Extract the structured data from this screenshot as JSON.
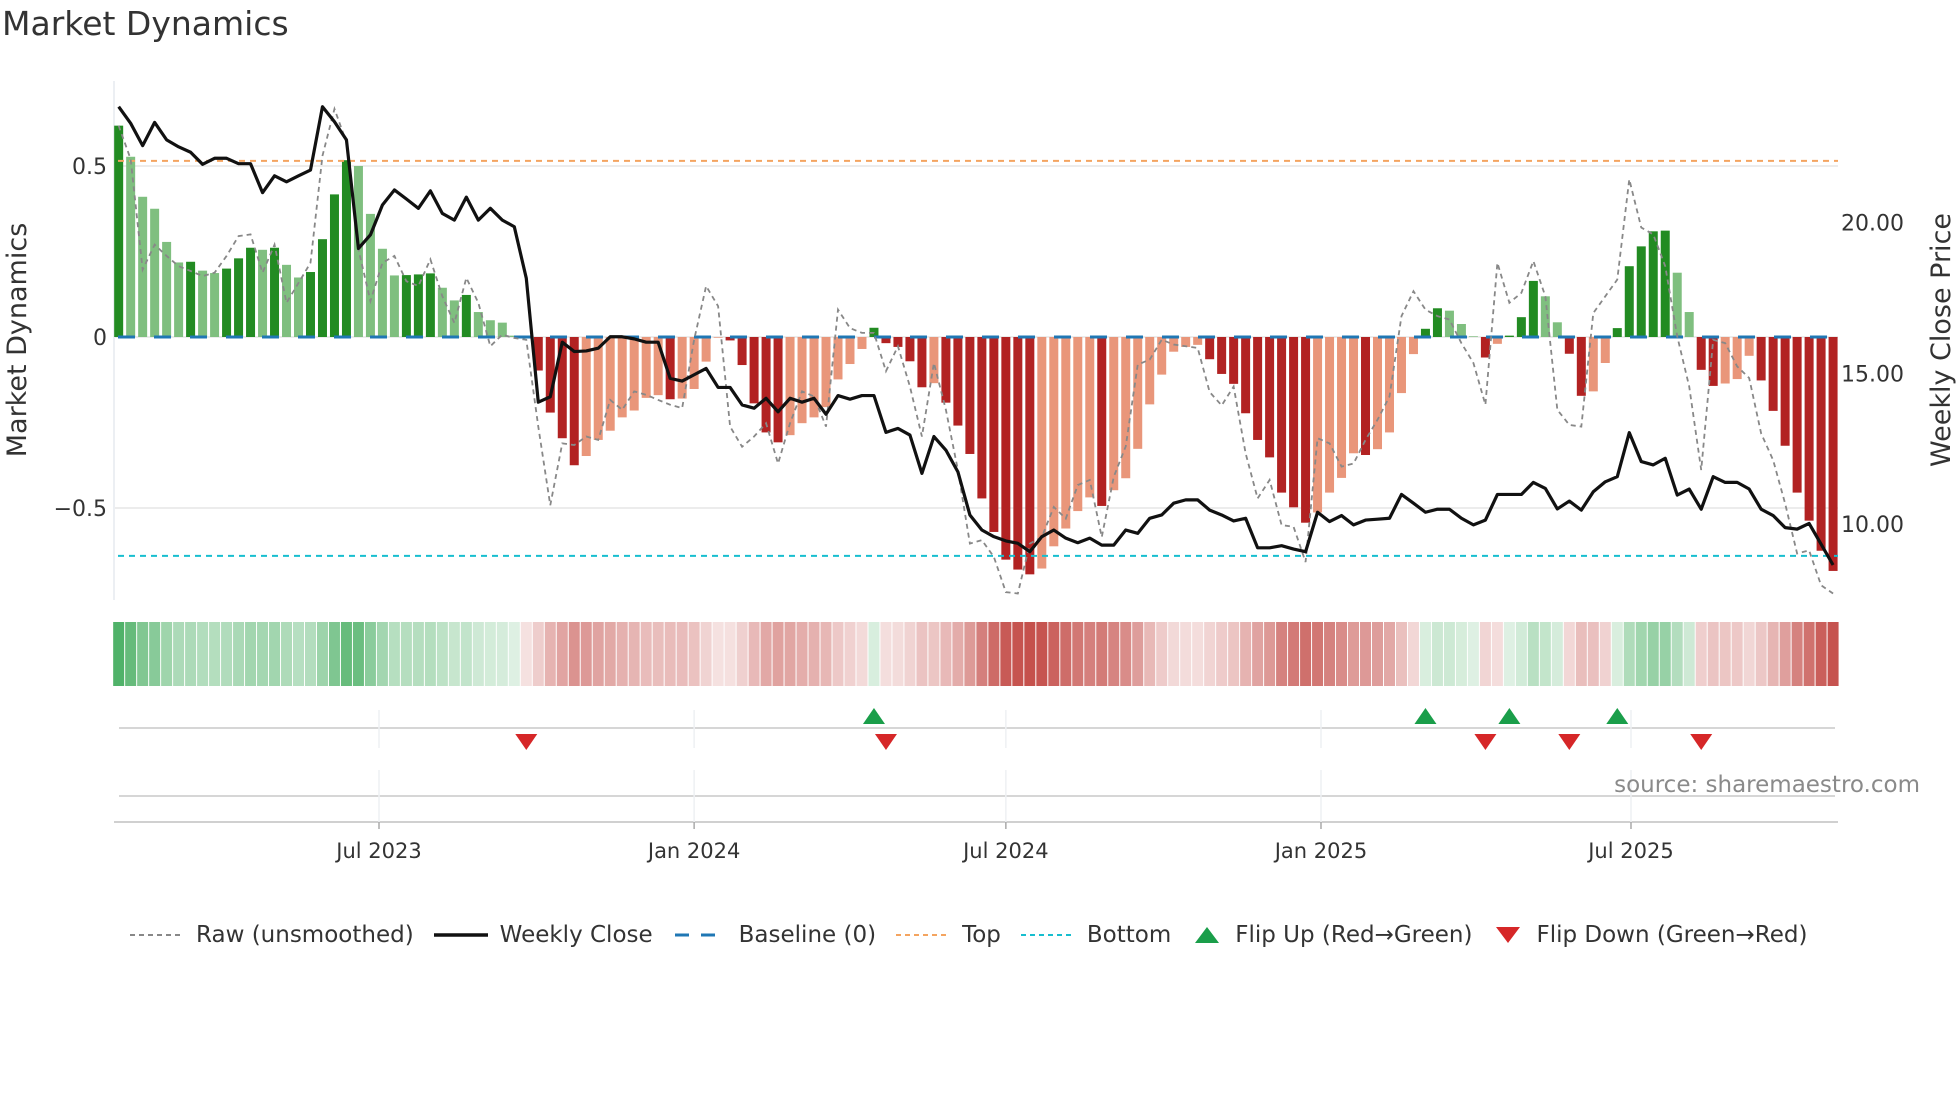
{
  "title": "Market Dynamics",
  "source": "source: sharemaestro.com",
  "colors": {
    "green_strong": "#228b22",
    "green_weak": "#7fbf7f",
    "red_strong": "#b22222",
    "red_weak": "#e9967a",
    "baseline": "#1f77b4",
    "top": "#f4a460",
    "bottom": "#17becf",
    "raw": "#888888",
    "close": "#111111",
    "flip_up": "#1a9e4a",
    "flip_down": "#d62728"
  },
  "legend": [
    {
      "key": "raw",
      "label": "Raw (unsmoothed)"
    },
    {
      "key": "close",
      "label": "Weekly Close"
    },
    {
      "key": "baseline",
      "label": "Baseline (0)"
    },
    {
      "key": "top",
      "label": "Top"
    },
    {
      "key": "bottom",
      "label": "Bottom"
    },
    {
      "key": "flip_up",
      "label": "Flip Up (Red→Green)"
    },
    {
      "key": "flip_down",
      "label": "Flip Down (Green→Red)"
    }
  ],
  "chart_data": {
    "type": "bar",
    "title": "Market Dynamics",
    "ylabel": "Market Dynamics",
    "y2label": "Weekly Close Price",
    "ylim": [
      -0.75,
      0.75
    ],
    "y2lim": [
      7.5,
      24.7
    ],
    "yticks": [
      {
        "v": 0.5,
        "label": "0.5"
      },
      {
        "v": 0,
        "label": "0"
      },
      {
        "v": -0.5,
        "label": "−0.5"
      }
    ],
    "y2ticks": [
      {
        "v": 20,
        "label": "20.00"
      },
      {
        "v": 15,
        "label": "15.00"
      },
      {
        "v": 10,
        "label": "10.00"
      }
    ],
    "xticks": [
      {
        "date": "2023-07-01",
        "label": "Jul 2023"
      },
      {
        "date": "2024-01-01",
        "label": "Jan 2024"
      },
      {
        "date": "2024-07-01",
        "label": "Jul 2024"
      },
      {
        "date": "2025-01-01",
        "label": "Jan 2025"
      },
      {
        "date": "2025-07-01",
        "label": "Jul 2025"
      }
    ],
    "first_week": "2023-01-30",
    "week_step_days": 7,
    "baseline": 0,
    "top": 0.515,
    "bottom": -0.64,
    "smoothed": [
      0.618,
      0.527,
      0.41,
      0.375,
      0.278,
      0.218,
      0.22,
      0.194,
      0.187,
      0.2,
      0.23,
      0.261,
      0.255,
      0.261,
      0.211,
      0.174,
      0.19,
      0.286,
      0.417,
      0.517,
      0.5,
      0.36,
      0.258,
      0.18,
      0.181,
      0.183,
      0.186,
      0.144,
      0.107,
      0.123,
      0.073,
      0.049,
      0.042,
      0.004,
      -0.004,
      -0.098,
      -0.221,
      -0.296,
      -0.375,
      -0.348,
      -0.301,
      -0.274,
      -0.235,
      -0.215,
      -0.178,
      -0.17,
      -0.182,
      -0.18,
      -0.152,
      -0.072,
      -0.002,
      -0.01,
      -0.082,
      -0.194,
      -0.279,
      -0.308,
      -0.287,
      -0.252,
      -0.235,
      -0.205,
      -0.124,
      -0.079,
      -0.035,
      0.027,
      -0.018,
      -0.029,
      -0.071,
      -0.147,
      -0.135,
      -0.192,
      -0.259,
      -0.342,
      -0.472,
      -0.57,
      -0.651,
      -0.68,
      -0.694,
      -0.677,
      -0.612,
      -0.56,
      -0.509,
      -0.469,
      -0.494,
      -0.448,
      -0.413,
      -0.327,
      -0.197,
      -0.11,
      -0.043,
      -0.029,
      -0.023,
      -0.065,
      -0.108,
      -0.137,
      -0.223,
      -0.301,
      -0.352,
      -0.455,
      -0.498,
      -0.543,
      -0.513,
      -0.455,
      -0.412,
      -0.34,
      -0.345,
      -0.328,
      -0.279,
      -0.164,
      -0.05,
      0.024,
      0.084,
      0.077,
      0.038,
      0.002,
      -0.06,
      -0.02,
      0.004,
      0.058,
      0.164,
      0.119,
      0.043,
      -0.049,
      -0.172,
      -0.159,
      -0.076,
      0.026,
      0.207,
      0.265,
      0.309,
      0.311,
      0.188,
      0.073,
      -0.096,
      -0.143,
      -0.136,
      -0.123,
      -0.055,
      -0.127,
      -0.216,
      -0.318,
      -0.455,
      -0.537,
      -0.625,
      -0.684
    ],
    "raw": [
      0.618,
      0.52,
      0.197,
      0.27,
      0.237,
      0.207,
      0.193,
      0.178,
      0.188,
      0.237,
      0.295,
      0.3,
      0.188,
      0.27,
      0.1,
      0.158,
      0.217,
      0.53,
      0.667,
      0.569,
      0.256,
      0.105,
      0.217,
      0.237,
      0.163,
      0.149,
      0.227,
      0.119,
      0.041,
      0.173,
      0.1,
      -0.027,
      0.007,
      -0.003,
      -0.008,
      -0.262,
      -0.492,
      -0.311,
      -0.316,
      -0.291,
      -0.301,
      -0.184,
      -0.213,
      -0.159,
      -0.169,
      -0.184,
      -0.198,
      -0.208,
      -0.008,
      0.149,
      0.09,
      -0.262,
      -0.321,
      -0.291,
      -0.252,
      -0.37,
      -0.252,
      -0.159,
      -0.174,
      -0.262,
      0.08,
      0.026,
      0.012,
      0.012,
      -0.1,
      -0.027,
      -0.145,
      -0.291,
      -0.076,
      -0.213,
      -0.389,
      -0.604,
      -0.594,
      -0.643,
      -0.746,
      -0.75,
      -0.604,
      -0.585,
      -0.497,
      -0.531,
      -0.433,
      -0.418,
      -0.585,
      -0.409,
      -0.32,
      -0.081,
      -0.066,
      -0.008,
      -0.022,
      -0.027,
      -0.032,
      -0.161,
      -0.2,
      -0.145,
      -0.34,
      -0.472,
      -0.418,
      -0.55,
      -0.555,
      -0.658,
      -0.296,
      -0.311,
      -0.379,
      -0.37,
      -0.301,
      -0.242,
      -0.174,
      0.061,
      0.134,
      0.08,
      0.061,
      0.051,
      -0.018,
      -0.076,
      -0.198,
      0.217,
      0.1,
      0.129,
      0.222,
      0.119,
      -0.213,
      -0.257,
      -0.262,
      0.07,
      0.119,
      0.168,
      0.461,
      0.32,
      0.3,
      0.207,
      0.002,
      -0.145,
      -0.389,
      -0.008,
      -0.018,
      -0.086,
      -0.12,
      -0.282,
      -0.36,
      -0.487,
      -0.633,
      -0.624,
      -0.726,
      -0.75
    ],
    "close": [
      23.84,
      23.29,
      22.55,
      23.32,
      22.74,
      22.51,
      22.33,
      21.93,
      22.13,
      22.13,
      21.95,
      21.95,
      20.99,
      21.55,
      21.35,
      21.55,
      21.74,
      23.84,
      23.34,
      22.74,
      19.14,
      19.59,
      20.58,
      21.08,
      20.78,
      20.47,
      21.05,
      20.3,
      20.08,
      20.84,
      20.08,
      20.47,
      20.08,
      19.86,
      18.15,
      14.04,
      14.22,
      16.03,
      15.72,
      15.74,
      15.83,
      16.21,
      16.21,
      16.14,
      16.03,
      16.03,
      14.83,
      14.74,
      14.95,
      15.16,
      14.53,
      14.53,
      13.95,
      13.84,
      14.17,
      13.72,
      14.17,
      14.04,
      14.17,
      13.64,
      14.26,
      14.14,
      14.26,
      14.26,
      13.04,
      13.17,
      12.95,
      11.68,
      12.9,
      12.45,
      11.73,
      10.3,
      9.8,
      9.58,
      9.44,
      9.36,
      9.08,
      9.58,
      9.8,
      9.53,
      9.38,
      9.53,
      9.3,
      9.3,
      9.8,
      9.69,
      10.19,
      10.3,
      10.69,
      10.8,
      10.8,
      10.46,
      10.3,
      10.1,
      10.19,
      9.21,
      9.21,
      9.28,
      9.17,
      9.08,
      10.39,
      10.08,
      10.28,
      9.97,
      10.13,
      10.16,
      10.19,
      10.98,
      10.69,
      10.39,
      10.49,
      10.49,
      10.19,
      9.97,
      10.13,
      10.98,
      10.98,
      10.98,
      11.38,
      11.18,
      10.5,
      10.76,
      10.46,
      11.07,
      11.4,
      11.57,
      13.03,
      12.07,
      11.96,
      12.18,
      10.96,
      11.16,
      10.49,
      11.57,
      11.38,
      11.38,
      11.16,
      10.49,
      10.28,
      9.88,
      9.83,
      10.02,
      9.33,
      8.64
    ],
    "flip_up_weeks": [
      64,
      110,
      117,
      126
    ],
    "flip_down_weeks": [
      35,
      65,
      115,
      122,
      133
    ],
    "legend_placement": "bottom"
  }
}
